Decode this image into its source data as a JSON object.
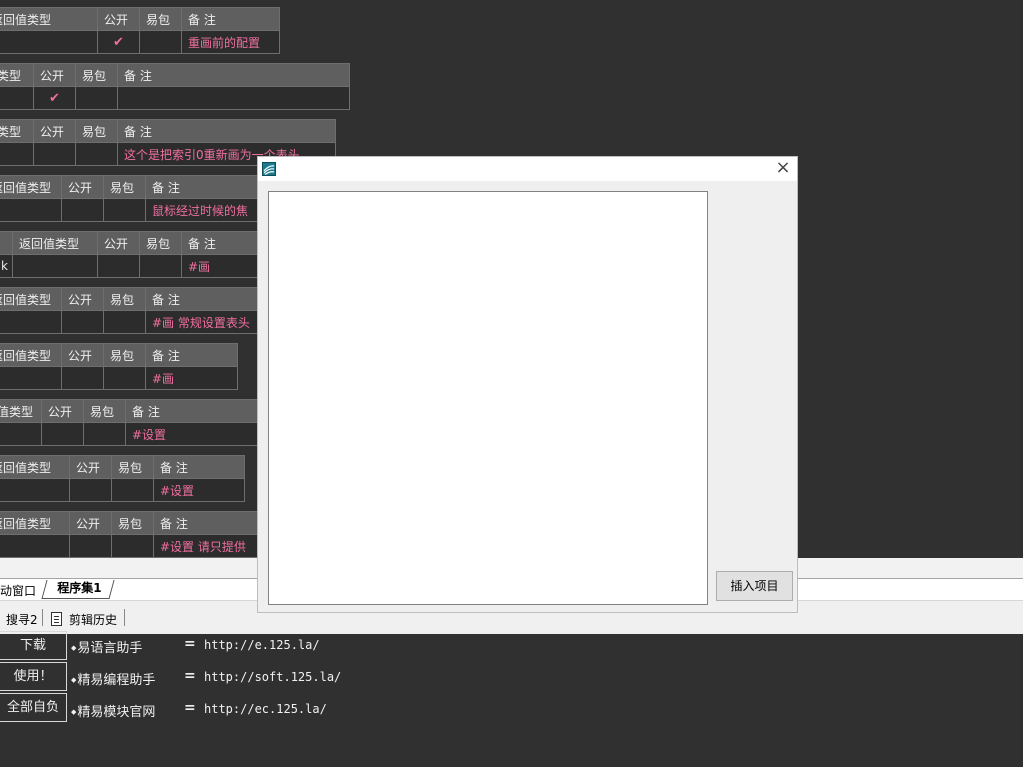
{
  "headers": {
    "ret_type": "返回值类型",
    "ret_type_c2": "值类型",
    "ret_type_c1": "类型",
    "ret_type_c3": "回值类型",
    "ret_type_c4": "返回值类型",
    "public": "公开",
    "easy": "易包",
    "note": "备 注"
  },
  "rows": [
    {
      "check": "✔",
      "note": "重画前的配置"
    },
    {
      "check": "✔",
      "note": ""
    },
    {
      "check": "",
      "note": "这个是把索引0重新画为一个表头"
    },
    {
      "check": "",
      "note": "鼠标经过时候的焦"
    },
    {
      "prefix": "k",
      "check": "",
      "note": "#画"
    },
    {
      "check": "",
      "note": "#画 常规设置表头"
    },
    {
      "check": "",
      "note": "#画"
    },
    {
      "check": "",
      "note": "#设置"
    },
    {
      "check": "",
      "note": "#设置"
    },
    {
      "check": "",
      "note": "#设置 请只提供"
    }
  ],
  "tabs": {
    "prev": "动窗口",
    "active": "程序集1"
  },
  "subbar": {
    "search": "搜寻2",
    "history": "剪辑历史"
  },
  "links": [
    {
      "button": "下载",
      "name": "易语言助手",
      "url": "http://e.125.la/"
    },
    {
      "button": "使用！",
      "name": "精易编程助手",
      "url": "http://soft.125.la/"
    },
    {
      "button": "全部自负",
      "name": "精易模块官网",
      "url": "http://ec.125.la/"
    }
  ],
  "dialog": {
    "close": "×",
    "insert_button": "插入项目"
  },
  "icons": {
    "app": "app-logo-icon",
    "close": "close-icon",
    "history": "clipboard-icon"
  }
}
